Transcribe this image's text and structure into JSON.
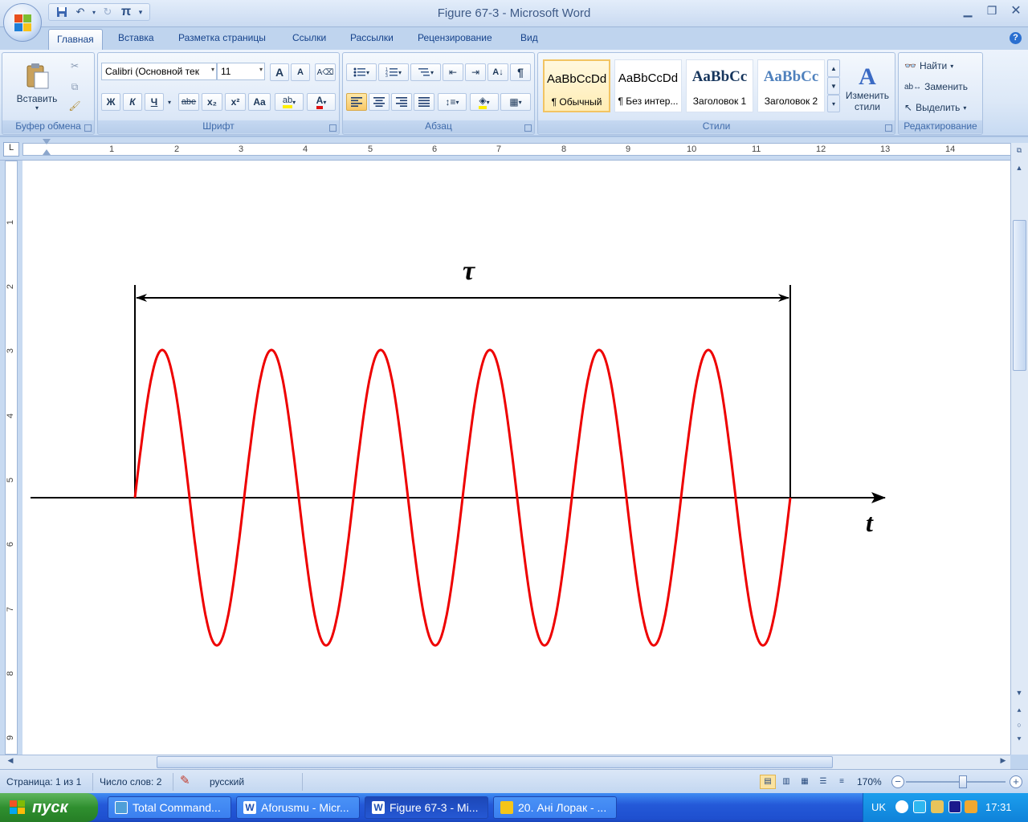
{
  "window": {
    "title": "Figure 67-3 - Microsoft Word"
  },
  "quick_access": {
    "undo_glyph": "↶",
    "redo_glyph": "↻",
    "pi_glyph": "π"
  },
  "tabs": [
    "Главная",
    "Вставка",
    "Разметка страницы",
    "Ссылки",
    "Рассылки",
    "Рецензирование",
    "Вид"
  ],
  "ribbon": {
    "clipboard": {
      "label": "Буфер обмена",
      "paste": "Вставить"
    },
    "font": {
      "label": "Шрифт",
      "font_name": "Calibri (Основной тек",
      "font_size": "11",
      "bold": "Ж",
      "italic": "К",
      "underline": "Ч",
      "strike": "abe",
      "subscript": "x₂",
      "superscript": "x²",
      "change_case": "Aa",
      "grow": "A",
      "shrink": "A"
    },
    "paragraph": {
      "label": "Абзац",
      "pilcrow": "¶"
    },
    "styles": {
      "label": "Стили",
      "items": [
        {
          "sample": "AaBbCcDd",
          "name": "¶ Обычный"
        },
        {
          "sample": "AaBbCcDd",
          "name": "¶ Без интер..."
        },
        {
          "sample": "AaBbCc",
          "name": "Заголовок 1"
        },
        {
          "sample": "AaBbCc",
          "name": "Заголовок 2"
        }
      ],
      "change_styles_line1": "Изменить",
      "change_styles_line2": "стили"
    },
    "editing": {
      "label": "Редактирование",
      "find": "Найти",
      "replace": "Заменить",
      "select": "Выделить"
    }
  },
  "ruler": {
    "corner": "L",
    "h_numbers": [
      "1",
      "2",
      "3",
      "4",
      "5",
      "6",
      "7",
      "8",
      "9",
      "10",
      "11",
      "12",
      "13",
      "14"
    ],
    "v_numbers": [
      "1",
      "2",
      "3",
      "4",
      "5",
      "6",
      "7",
      "8",
      "9"
    ]
  },
  "figure": {
    "tau_label": "τ",
    "t_label": "t",
    "cycles": 6,
    "wave_color": "#ee0000"
  },
  "statusbar": {
    "page": "Страница: 1 из 1",
    "words": "Число слов: 2",
    "language": "русский",
    "zoom": "170%"
  },
  "taskbar": {
    "start": "пуск",
    "tasks": [
      "Total Command...",
      "Aforusmu - Micr...",
      "Figure 67-3 - Mi...",
      "20. Ані Лорак - ..."
    ],
    "lang": "UK",
    "time": "17:31"
  }
}
